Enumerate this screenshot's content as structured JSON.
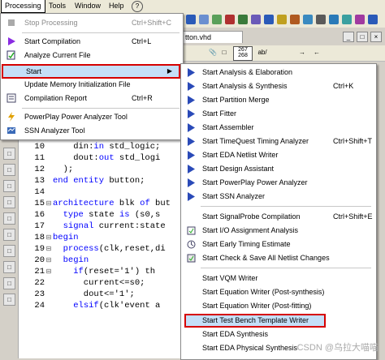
{
  "menubar": {
    "items": [
      {
        "label": "Processing"
      },
      {
        "label": "Tools"
      },
      {
        "label": "Window"
      },
      {
        "label": "Help"
      }
    ]
  },
  "editor": {
    "tab_label": "tton.vhd",
    "toolbar": {
      "label_a": "267\n268",
      "label_b": "ab/"
    },
    "code_lines": [
      {
        "ln": "10",
        "fold": "",
        "text": "    din:in std_logic;"
      },
      {
        "ln": "11",
        "fold": "",
        "text": "    dout:out std_logi"
      },
      {
        "ln": "12",
        "fold": "",
        "text": "  );"
      },
      {
        "ln": "13",
        "fold": "",
        "text": "end entity button;"
      },
      {
        "ln": "14",
        "fold": "",
        "text": ""
      },
      {
        "ln": "15",
        "fold": "⊟",
        "text": "architecture blk of but"
      },
      {
        "ln": "16",
        "fold": "",
        "text": "  type state is (s0,s"
      },
      {
        "ln": "17",
        "fold": "",
        "text": "  signal current:state"
      },
      {
        "ln": "18",
        "fold": "⊟",
        "text": "begin"
      },
      {
        "ln": "19",
        "fold": "⊟",
        "text": "  process(clk,reset,di"
      },
      {
        "ln": "20",
        "fold": "⊟",
        "text": "  begin"
      },
      {
        "ln": "21",
        "fold": "⊟",
        "text": "    if(reset='1') th"
      },
      {
        "ln": "22",
        "fold": "",
        "text": "      current<=s0;"
      },
      {
        "ln": "23",
        "fold": "",
        "text": "      dout<='1';"
      },
      {
        "ln": "24",
        "fold": "",
        "text": "    elsif(clk'event a"
      }
    ]
  },
  "processing_menu": {
    "items": [
      {
        "label": "Stop Processing",
        "shortcut": "Ctrl+Shift+C",
        "icon": "stop-icon",
        "disabled": true
      },
      {
        "label": "Start Compilation",
        "shortcut": "Ctrl+L",
        "icon": "play-icon"
      },
      {
        "label": "Analyze Current File",
        "shortcut": "",
        "icon": "analyze-file-icon"
      },
      {
        "label": "Start",
        "shortcut": "",
        "icon": "",
        "submenu": true
      },
      {
        "label": "Update Memory Initialization File",
        "shortcut": "",
        "icon": ""
      },
      {
        "label": "Compilation Report",
        "shortcut": "Ctrl+R",
        "icon": "report-icon"
      },
      {
        "label": "PowerPlay Power Analyzer Tool",
        "shortcut": "",
        "icon": "power-icon"
      },
      {
        "label": "SSN Analyzer Tool",
        "shortcut": "",
        "icon": "ssn-icon"
      }
    ]
  },
  "start_submenu": {
    "items": [
      {
        "label": "Start Analysis & Elaboration",
        "shortcut": ""
      },
      {
        "label": "Start Analysis & Synthesis",
        "shortcut": "Ctrl+K"
      },
      {
        "label": "Start Partition Merge",
        "shortcut": ""
      },
      {
        "label": "Start Fitter",
        "shortcut": ""
      },
      {
        "label": "Start Assembler",
        "shortcut": ""
      },
      {
        "label": "Start TimeQuest Timing Analyzer",
        "shortcut": "Ctrl+Shift+T"
      },
      {
        "label": "Start EDA Netlist Writer",
        "shortcut": ""
      },
      {
        "label": "Start Design Assistant",
        "shortcut": ""
      },
      {
        "label": "Start PowerPlay Power Analyzer",
        "shortcut": ""
      },
      {
        "label": "Start SSN Analyzer",
        "shortcut": ""
      },
      {
        "label": "Start SignalProbe Compilation",
        "shortcut": "Ctrl+Shift+E"
      },
      {
        "label": "Start I/O Assignment Analysis",
        "shortcut": ""
      },
      {
        "label": "Start Early Timing Estimate",
        "shortcut": ""
      },
      {
        "label": "Start Check & Save All Netlist Changes",
        "shortcut": ""
      },
      {
        "label": "Start VQM Writer",
        "shortcut": ""
      },
      {
        "label": "Start Equation Writer (Post-synthesis)",
        "shortcut": ""
      },
      {
        "label": "Start Equation Writer (Post-fitting)",
        "shortcut": ""
      },
      {
        "label": "Start Test Bench Template Writer",
        "shortcut": ""
      },
      {
        "label": "Start EDA Synthesis",
        "shortcut": ""
      },
      {
        "label": "Start EDA Physical Synthesis",
        "shortcut": ""
      }
    ]
  },
  "watermark": "CSDN @乌拉大喵喵",
  "colors": {
    "highlight_border": "#d60000",
    "highlight_fill": "#c5dff8",
    "keyword": "#0000ff"
  }
}
